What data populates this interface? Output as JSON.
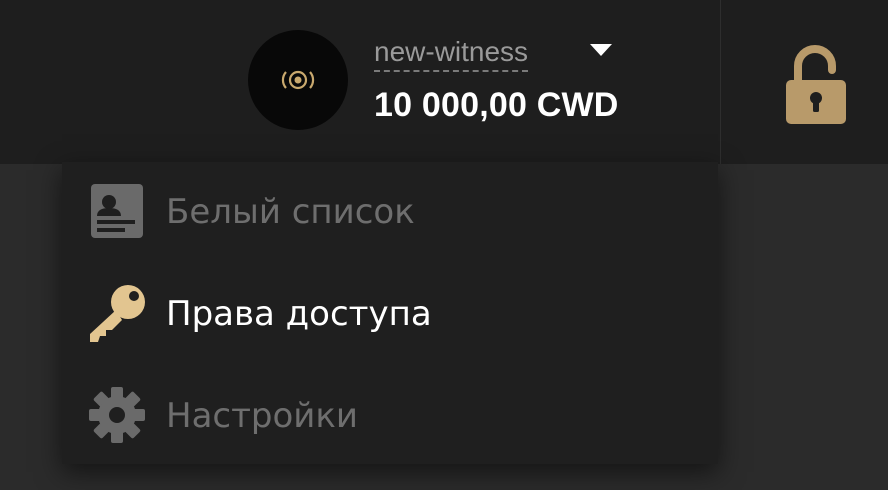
{
  "header": {
    "account": {
      "avatar_icon": "broadcast-icon",
      "name": "new-witness",
      "balance": "10 000,00 CWD"
    },
    "lock_icon": "unlocked-padlock-icon",
    "colors": {
      "accent": "#b89a6a",
      "background": "#1e1e1e"
    }
  },
  "menu": {
    "items": [
      {
        "label": "Белый список",
        "icon": "contact-card-icon",
        "state": "disabled"
      },
      {
        "label": "Права доступа",
        "icon": "key-icon",
        "state": "active"
      },
      {
        "label": "Настройки",
        "icon": "gear-icon",
        "state": "disabled"
      }
    ]
  }
}
